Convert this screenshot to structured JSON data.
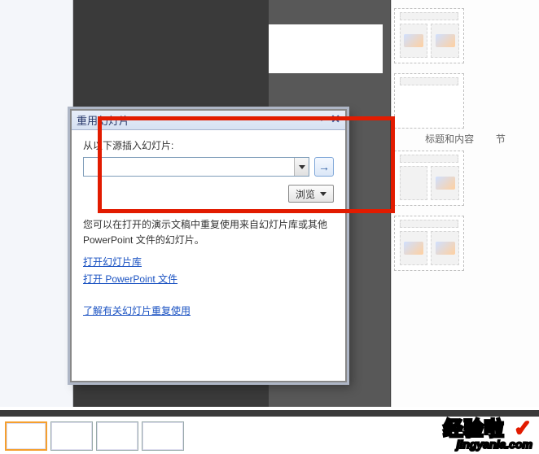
{
  "pane": {
    "title": "重用幻灯片",
    "insert_label": "从以下源插入幻灯片:",
    "combo_value": "",
    "go_icon": "→",
    "browse_label": "浏览",
    "description": "您可以在打开的演示文稿中重复使用来自幻灯片库或其他 PowerPoint 文件的幻灯片。",
    "link_open_library": "打开幻灯片库",
    "link_open_file": "打开 PowerPoint 文件",
    "link_learn_more": "了解有关幻灯片重复使用",
    "close": "✕"
  },
  "layouts": {
    "cap1": "标题和内容",
    "cap2": "节"
  },
  "brand": {
    "name": "经验啦",
    "check": "✓",
    "domain": "jingyanla.com"
  }
}
